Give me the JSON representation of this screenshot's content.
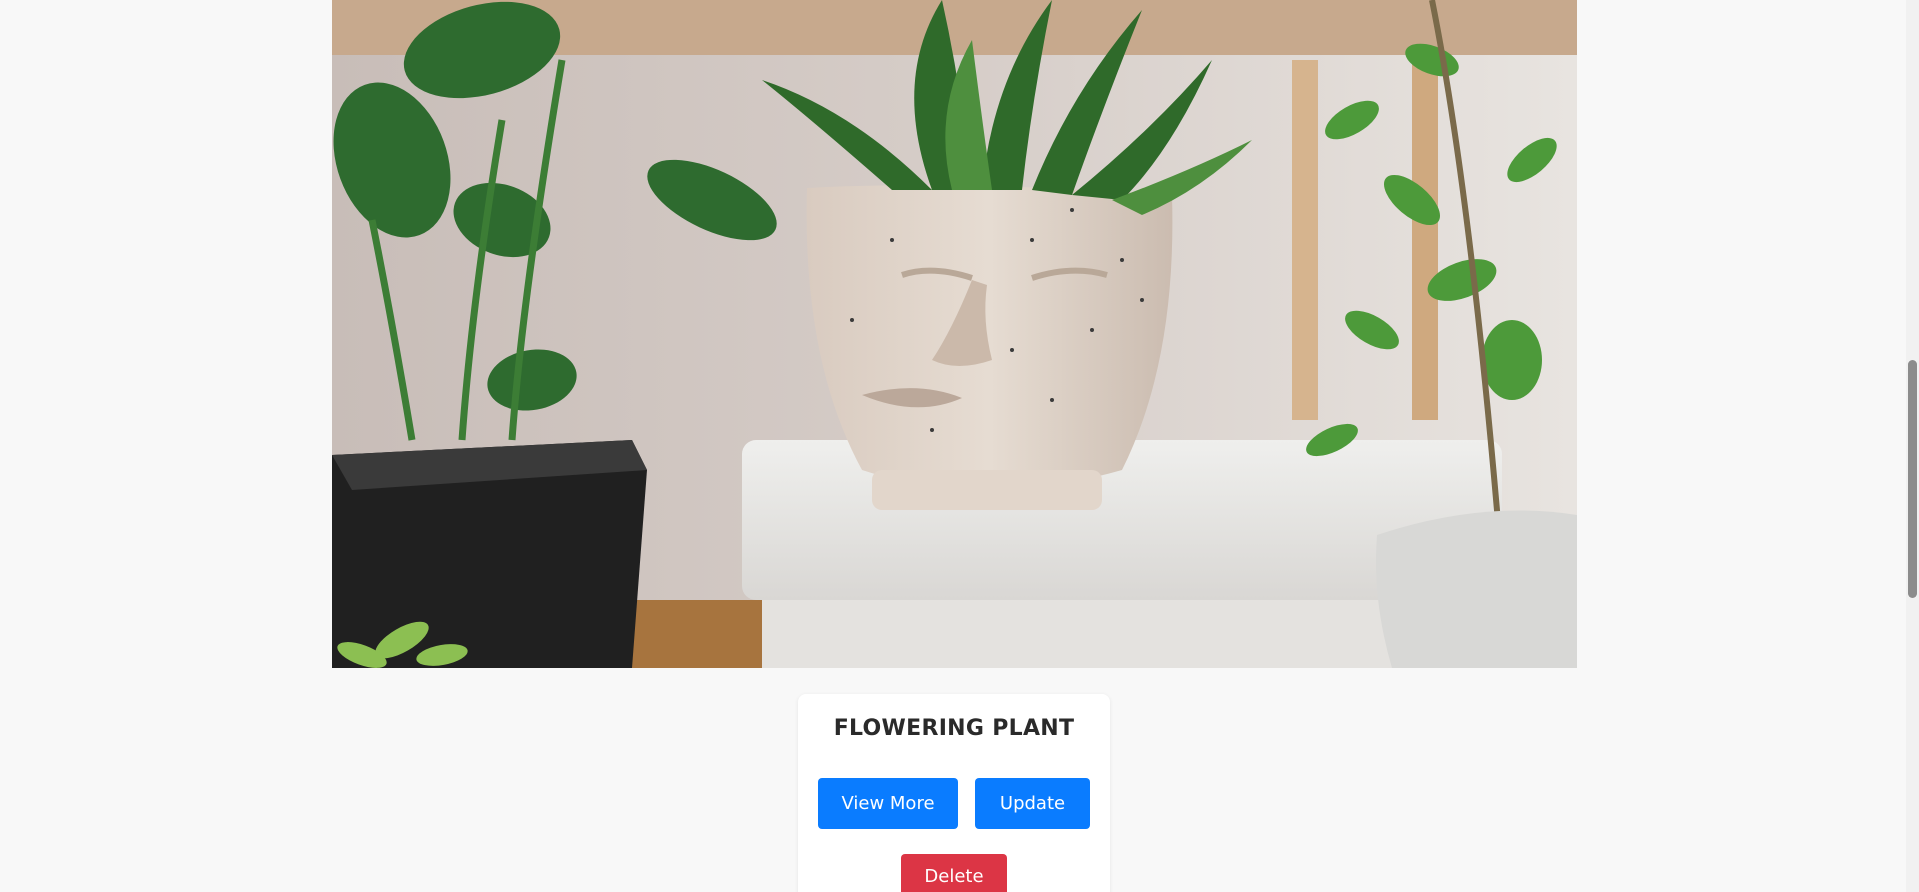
{
  "product": {
    "image_alt": "Plants in pots",
    "title": "FLOWERING PLANT"
  },
  "actions": {
    "view_more_label": "View More",
    "update_label": "Update",
    "delete_label": "Delete"
  },
  "colors": {
    "primary": "#0a7cff",
    "danger": "#dc3545",
    "background": "#f8f8f8"
  }
}
